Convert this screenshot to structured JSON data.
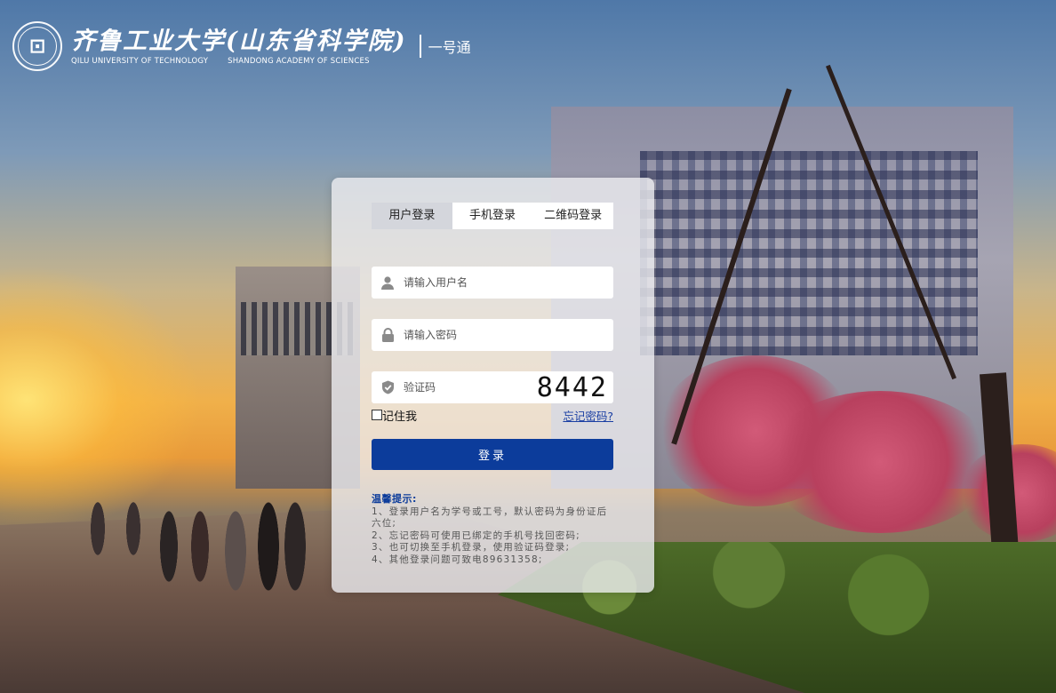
{
  "header": {
    "university_cn": "齐鲁工业大学(山东省科学院)",
    "university_en": "QILU UNIVERSITY OF TECHNOLOGY",
    "academy_en": "SHANDONG  ACADEMY  OF  SCIENCES",
    "portal": "一号通"
  },
  "tabs": [
    {
      "label": "用户登录",
      "active": true
    },
    {
      "label": "手机登录",
      "active": false
    },
    {
      "label": "二维码登录",
      "active": false
    }
  ],
  "form": {
    "username_placeholder": "请输入用户名",
    "password_placeholder": "请输入密码",
    "captcha_placeholder": "验证码",
    "captcha_code": "8442",
    "remember_label": "记住我",
    "forgot_label": "忘记密码?",
    "login_label": "登录"
  },
  "tips": {
    "title": "温馨提示:",
    "lines": [
      "1、登录用户名为学号或工号，默认密码为身份证后六位;",
      "2、忘记密码可使用已绑定的手机号找回密码;",
      "3、也可切换至手机登录，使用验证码登录;",
      "4、其他登录问题可致电89631358;"
    ]
  },
  "colors": {
    "primary": "#0c3c9b",
    "link": "#1a3fa3",
    "tab_active_bg": "#d4d6dc"
  },
  "icons": [
    "user-icon",
    "lock-icon",
    "shield-icon",
    "university-emblem"
  ]
}
